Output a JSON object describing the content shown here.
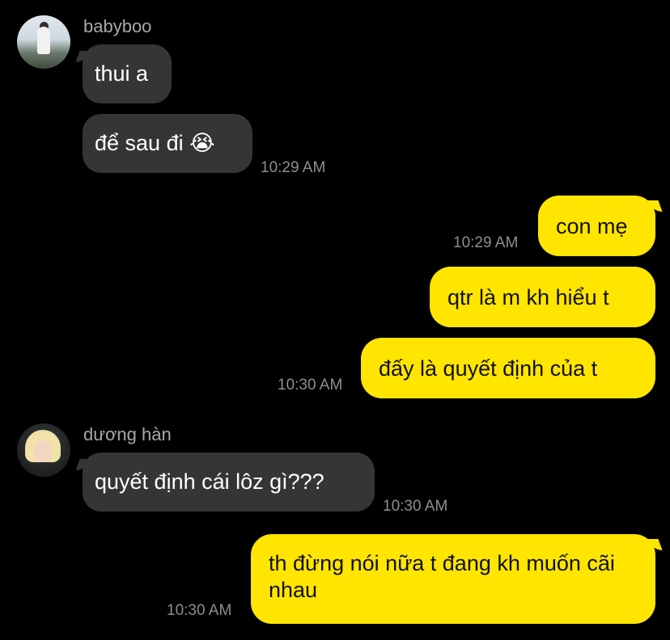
{
  "messages": [
    {
      "sender": "babyboo",
      "text": "thui a"
    },
    {
      "sender": "babyboo",
      "text": "để sau đi",
      "emoji": "😭",
      "time": "10:29 AM"
    },
    {
      "sender": "me",
      "text": "con mẹ",
      "time": "10:29 AM"
    },
    {
      "sender": "me",
      "text": "qtr là m kh hiểu t"
    },
    {
      "sender": "me",
      "text": "đấy là quyết định của t",
      "time": "10:30 AM"
    },
    {
      "sender": "dương hàn",
      "text": "quyết định cái lôz gì???",
      "time": "10:30 AM"
    },
    {
      "sender": "me",
      "text": "th đừng nói nữa t đang kh muốn cãi nhau",
      "time": "10:30 AM"
    }
  ],
  "colors": {
    "incoming_bubble": "#353535",
    "outgoing_bubble": "#ffe500",
    "background": "#000000"
  }
}
